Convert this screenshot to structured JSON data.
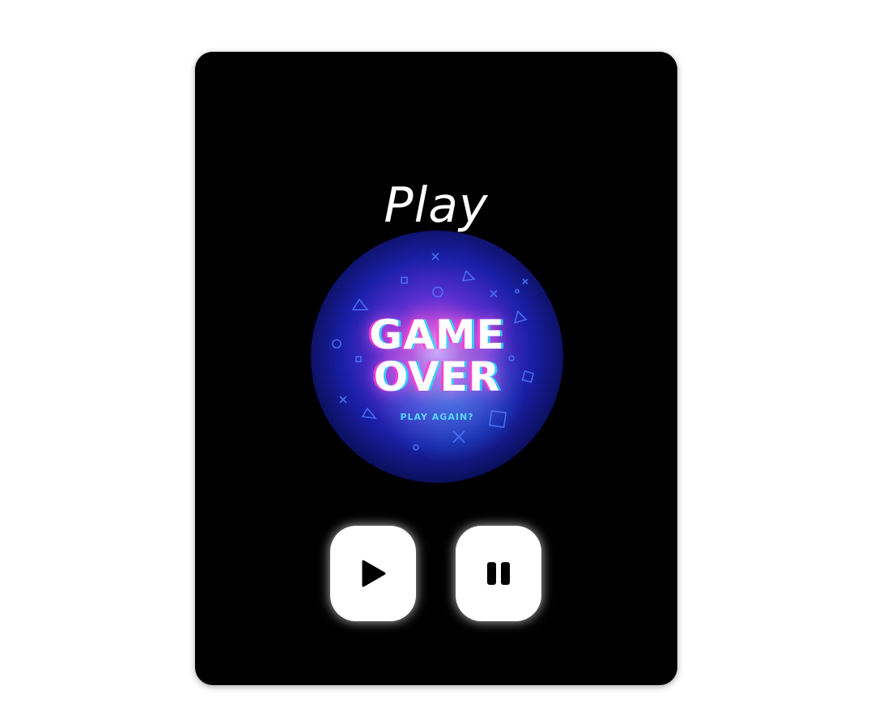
{
  "player": {
    "title": "Play",
    "artwork": {
      "line1": "GAME",
      "line2": "OVER",
      "subtitle": "PLAY AGAIN?"
    },
    "controls": {
      "play_icon": "play-icon",
      "pause_icon": "pause-icon"
    }
  },
  "colors": {
    "card_background": "#000000",
    "page_background": "#ffffff",
    "button_background": "#ffffff",
    "glow_pink": "#ff3cd2",
    "glow_cyan": "#28dcff",
    "disc_blue": "#1a1fa8"
  }
}
